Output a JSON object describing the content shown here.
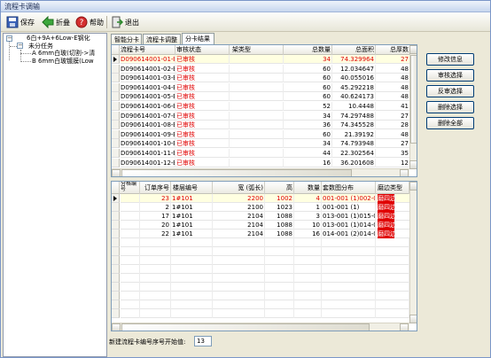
{
  "window": {
    "title": "流程卡调输"
  },
  "toolbar": {
    "save": "保存",
    "undo": "折叠",
    "help": "帮助",
    "exit": "退出"
  },
  "tree": {
    "root": "6白+9A+6Low-E钢化",
    "group": "未分任务",
    "items": [
      "A 6mm白玻(切割->清",
      "B 6mm白玻镀膜(Low"
    ]
  },
  "tabs": [
    "智能分卡",
    "流程卡调整",
    "分卡结果"
  ],
  "top_table": {
    "columns": [
      "流程卡号",
      "审核状态",
      "架类型",
      "总数量",
      "总面积",
      "总厚数"
    ],
    "rows": [
      [
        "D090614001-01-B",
        "已审核",
        "",
        "34",
        "74.329964",
        "27"
      ],
      [
        "D090614001-02-B",
        "已审核",
        "",
        "60",
        "12.034647",
        "48"
      ],
      [
        "D090614001-03-B",
        "已审核",
        "",
        "60",
        "40.055016",
        "48"
      ],
      [
        "D090614001-04-B",
        "已审核",
        "",
        "60",
        "45.292218",
        "48"
      ],
      [
        "D090614001-05-B",
        "已审核",
        "",
        "60",
        "40.624173",
        "48"
      ],
      [
        "D090614001-06-B",
        "已审核",
        "",
        "52",
        "10.4448",
        "41"
      ],
      [
        "D090614001-07-B",
        "已审核",
        "",
        "34",
        "74.297488",
        "27"
      ],
      [
        "D090614001-08-B",
        "已审核",
        "",
        "36",
        "74.345528",
        "28"
      ],
      [
        "D090614001-09-B",
        "已审核",
        "",
        "60",
        "21.39192",
        "48"
      ],
      [
        "D090614001-10-B",
        "已审核",
        "",
        "34",
        "74.793948",
        "27"
      ],
      [
        "D090614001-11-B",
        "已审核",
        "",
        "44",
        "22.302564",
        "35"
      ],
      [
        "D090614001-12-B",
        "已审核",
        "",
        "16",
        "36.201608",
        "12"
      ]
    ]
  },
  "bottom_table": {
    "columns": [
      "分格编号",
      "订单序号",
      "楼层编号",
      "宽 (弧长)",
      "高",
      "数量",
      "套数图分布",
      "磨边类型"
    ],
    "rows": [
      [
        "",
        "23",
        "1#101",
        "2200",
        "1002",
        "4",
        "001-001 (1)002-0",
        "磨四边"
      ],
      [
        "",
        "2",
        "1#101",
        "2100",
        "1023",
        "1",
        "001-001 (1)",
        "磨四边"
      ],
      [
        "",
        "17",
        "1#101",
        "2104",
        "1088",
        "3",
        "013-001 (1)015-0",
        "磨四边"
      ],
      [
        "",
        "20",
        "1#101",
        "2104",
        "1088",
        "10",
        "013-001 (1)014-0",
        "磨四边"
      ],
      [
        "",
        "22",
        "1#101",
        "2104",
        "1088",
        "16",
        "014-001 (2)014-0",
        "磨四边"
      ]
    ]
  },
  "buttons": [
    "修改信息",
    "审核选择",
    "反审选择",
    "删除选择",
    "删除全部"
  ],
  "footer": {
    "label": "新建流程卡编号序号开始值:",
    "value": "13"
  },
  "colors": {
    "selected_row": "#ffffe1",
    "status_red": "#e00000",
    "window_bg": "#ece9d8"
  }
}
